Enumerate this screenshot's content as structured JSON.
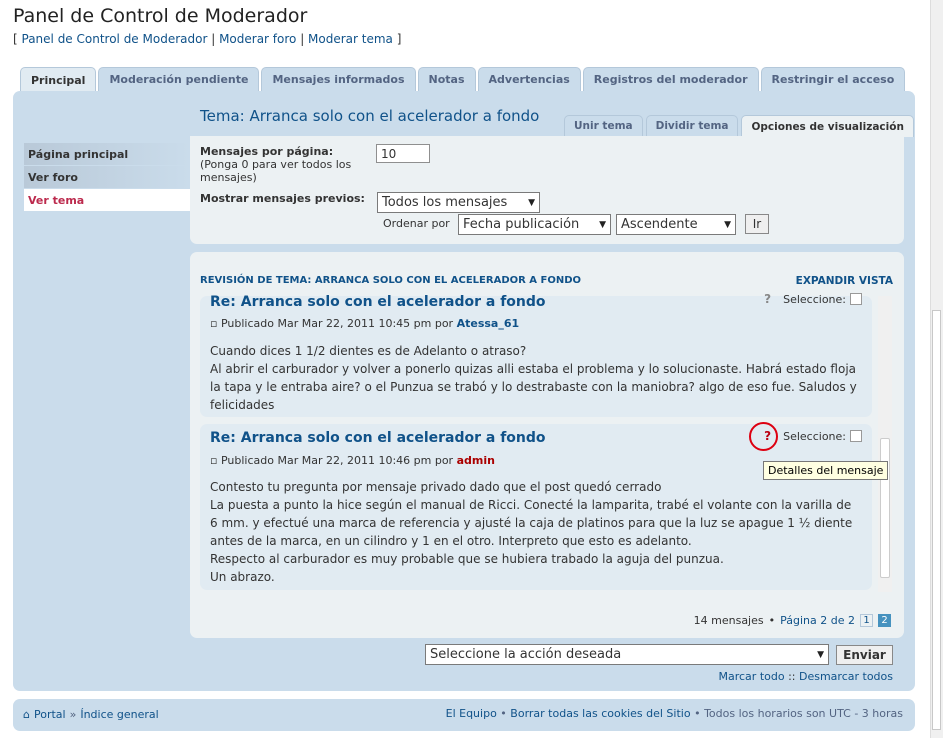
{
  "header": {
    "title": "Panel de Control de Moderador",
    "links": [
      "Panel de Control de Moderador",
      "Moderar foro",
      "Moderar tema"
    ]
  },
  "tabs": [
    "Principal",
    "Moderación pendiente",
    "Mensajes informados",
    "Notas",
    "Advertencias",
    "Registros del moderador",
    "Restringir el acceso"
  ],
  "sidebar": [
    "Página principal",
    "Ver foro",
    "Ver tema"
  ],
  "topic_title": "Tema: Arranca solo con el acelerador a fondo",
  "subtabs": [
    "Unir tema",
    "Dividir tema",
    "Opciones de visualización"
  ],
  "options": {
    "per_page_label": "Mensajes por página:",
    "per_page_hint": "(Ponga 0 para ver todos los mensajes)",
    "per_page_value": "10",
    "show_prev_label": "Mostrar mensajes previos:",
    "show_prev_value": "Todos los mensajes",
    "order_label": "Ordenar por",
    "order_field": "Fecha publicación",
    "order_dir": "Ascendente",
    "go": "Ir"
  },
  "review": {
    "heading": "REVISIÓN DE TEMA: ARRANCA SOLO CON EL ACELERADOR A FONDO",
    "expand": "EXPANDIR VISTA"
  },
  "posts": [
    {
      "title": "Re: Arranca solo con el acelerador a fondo",
      "meta": "Publicado Mar Mar 22, 2011 10:45 pm por",
      "author": "Atessa_61",
      "select": "Seleccione:",
      "lines": [
        "Cuando dices 1 1/2 dientes es de Adelanto o atraso?",
        "Al abrir el carburador y volver a ponerlo quizas alli estaba el problema y lo solucionaste. Habrá estado floja la tapa y le entraba aire? o el Punzua se trabó y lo destrabaste con la maniobra? algo de eso fue. Saludos y felicidades"
      ]
    },
    {
      "title": "Re: Arranca solo con el acelerador a fondo",
      "meta": "Publicado Mar Mar 22, 2011 10:46 pm por",
      "author": "admin",
      "select": "Seleccione:",
      "lines": [
        "Contesto tu pregunta por mensaje privado dado que el post quedó cerrado",
        "La puesta a punto la hice según el manual de Ricci. Conecté la lamparita, trabé el volante con la varilla de 6 mm. y efectué una marca de referencia y ajusté la caja de platinos para que la luz se apague 1 ½ diente antes de la marca, en un cilindro y 1 en el otro. Interpreto que esto es adelanto.",
        "Respecto al carburador es muy probable que se hubiera trabado la aguja del punzua.",
        "Un abrazo."
      ]
    }
  ],
  "tooltip": "Detalles del mensaje",
  "pagination": {
    "count": "14 mensajes",
    "page": "Página 2 de 2",
    "pages": [
      "1",
      "2"
    ]
  },
  "action": {
    "select": "Seleccione la acción deseada",
    "submit": "Enviar",
    "mark_all": "Marcar todo",
    "sep": "::",
    "unmark_all": "Desmarcar todos"
  },
  "footer": {
    "portal": "Portal",
    "index": "Índice general",
    "team": "El Equipo",
    "cookies": "Borrar todas las cookies del Sitio",
    "tz": "Todos los horarios son UTC - 3 horas"
  },
  "colors": {
    "link": "#105289",
    "admin": "#AA0000",
    "panel": "#cadceb"
  }
}
